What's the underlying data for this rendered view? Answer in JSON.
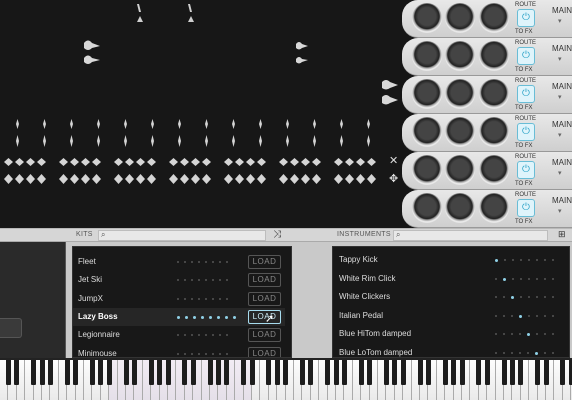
{
  "browser": {
    "kits_label": "KITS",
    "instruments_label": "INSTRUMENTS"
  },
  "tracks": [
    {
      "route_label": "ROUTE",
      "tofx_label": "TO FX",
      "main_label": "MAIN"
    },
    {
      "route_label": "ROUTE",
      "tofx_label": "TO FX",
      "main_label": "MAIN"
    },
    {
      "route_label": "ROUTE",
      "tofx_label": "TO FX",
      "main_label": "MAIN"
    },
    {
      "route_label": "ROUTE",
      "tofx_label": "TO FX",
      "main_label": "MAIN"
    },
    {
      "route_label": "ROUTE",
      "tofx_label": "TO FX",
      "main_label": "MAIN"
    },
    {
      "route_label": "ROUTE",
      "tofx_label": "TO FX",
      "main_label": "MAIN"
    }
  ],
  "kits": [
    {
      "name": "Fleet",
      "load": "LOAD"
    },
    {
      "name": "Jet Ski",
      "load": "LOAD"
    },
    {
      "name": "JumpX",
      "load": "LOAD"
    },
    {
      "name": "Lazy Boss",
      "load": "LOAD",
      "selected": true
    },
    {
      "name": "Legionnaire",
      "load": "LOAD"
    },
    {
      "name": "Minimouse",
      "load": "LOAD"
    }
  ],
  "instruments": [
    {
      "name": "Tappy Kick",
      "active_dot": 0
    },
    {
      "name": "White Rim Click",
      "active_dot": 1
    },
    {
      "name": "White Clickers",
      "active_dot": 2
    },
    {
      "name": "Italian Pedal",
      "active_dot": 3
    },
    {
      "name": "Blue HiTom damped",
      "active_dot": 4
    },
    {
      "name": "Blue LoTom damped",
      "active_dot": 5
    }
  ],
  "icons": {
    "search": "search-icon",
    "shuffle": "shuffle-icon",
    "grid": "grid-icon",
    "close": "close-icon",
    "move": "move-icon",
    "power": "power-icon"
  },
  "colors": {
    "accent": "#8fd0e6",
    "route_button": "#2ea4c8"
  }
}
